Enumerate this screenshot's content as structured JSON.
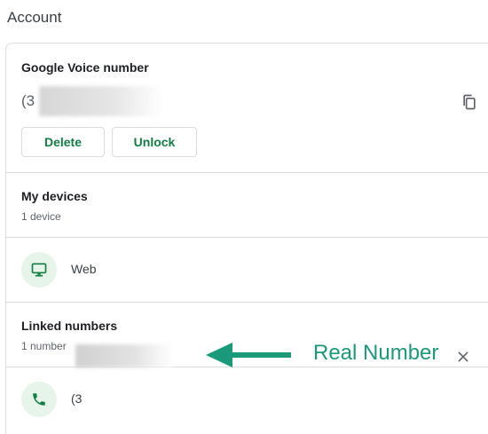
{
  "page": {
    "title": "Account"
  },
  "voice": {
    "title": "Google Voice number",
    "number_partial": "(3",
    "delete_label": "Delete",
    "unlock_label": "Unlock",
    "copy_icon": "copy-icon"
  },
  "devices": {
    "title": "My devices",
    "count": "1 device",
    "items": [
      {
        "label": "Web",
        "icon": "monitor-icon"
      }
    ]
  },
  "linked": {
    "title": "Linked numbers",
    "count": "1 number",
    "items": [
      {
        "number_partial": "(3",
        "icon": "phone-icon"
      }
    ],
    "remove_icon": "close-icon"
  },
  "annotation": {
    "text": "Real Number",
    "color": "#1a9a7b",
    "arrow_icon": "left-arrow-icon"
  },
  "colors": {
    "accent": "#137e43",
    "icon_bg": "#e6f4ea",
    "divider": "#dadce0"
  }
}
